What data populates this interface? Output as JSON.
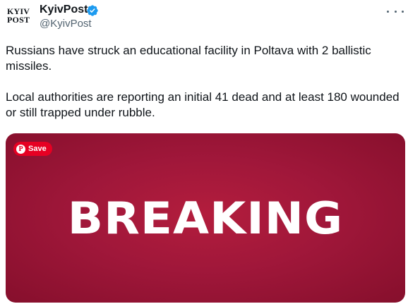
{
  "author": {
    "logo_line1": "KYIV",
    "logo_line2": "POST",
    "display_name": "KyivPost",
    "handle": "@KyivPost",
    "verified": true,
    "verified_color": "#1d9bf0"
  },
  "tweet": {
    "paragraph1": "Russians have struck an educational facility in Poltava with 2 ballistic missiles.",
    "paragraph2": "Local authorities are reporting an initial 41 dead and at least 180 wounded or still trapped under rubble."
  },
  "media": {
    "headline": "BREAKING",
    "background_color": "#a0173a",
    "save_button_label": "Save",
    "save_button_color": "#e60023"
  },
  "icons": {
    "more": "more-horizontal-icon",
    "verified": "verified-badge-icon",
    "pinterest": "pinterest-icon"
  }
}
